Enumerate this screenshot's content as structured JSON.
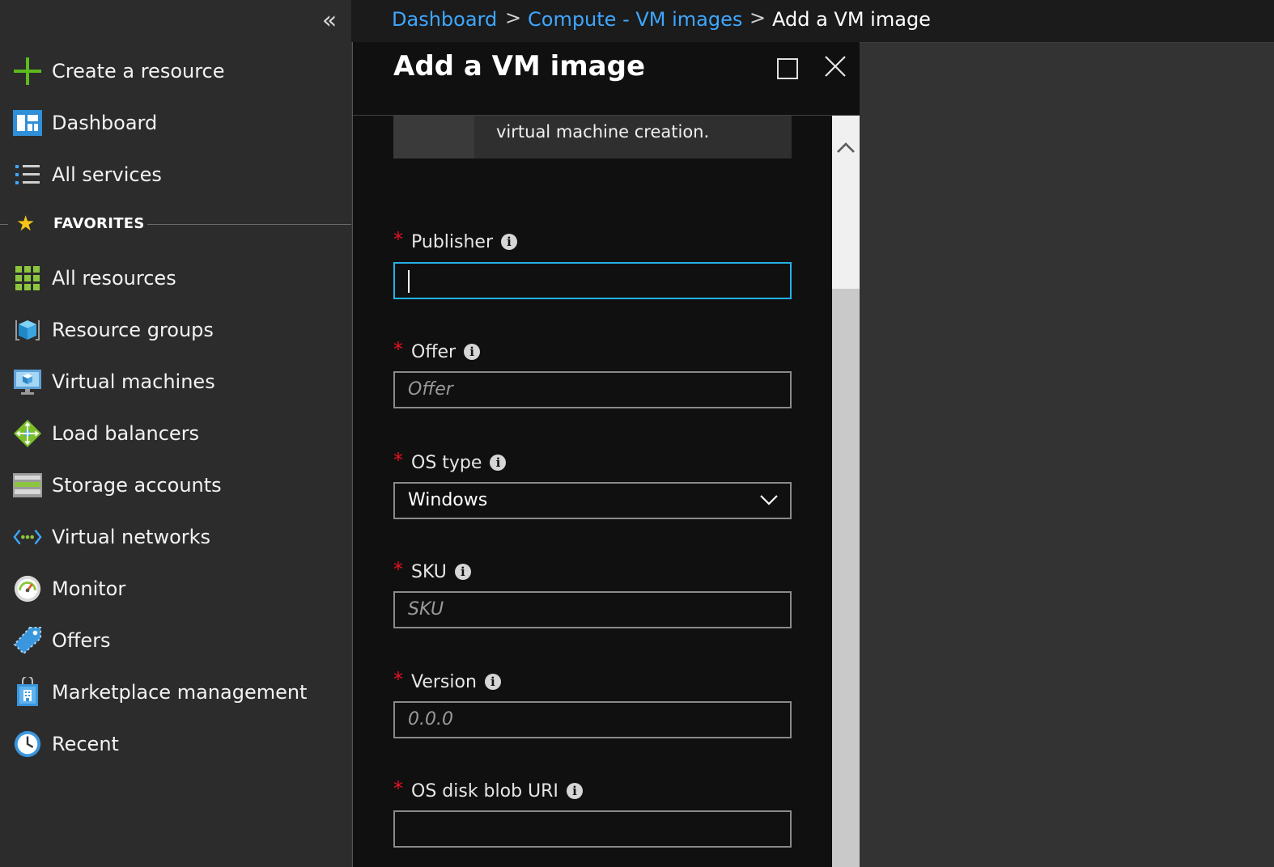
{
  "sidebar": {
    "collapse_label": "«",
    "top_items": [
      {
        "label": "Create a resource",
        "icon": "plus-icon"
      },
      {
        "label": "Dashboard",
        "icon": "dashboard-icon"
      },
      {
        "label": "All services",
        "icon": "list-icon"
      }
    ],
    "favorites_label": "FAVORITES",
    "favorites": [
      {
        "label": "All resources",
        "icon": "grid-icon"
      },
      {
        "label": "Resource groups",
        "icon": "cube-icon"
      },
      {
        "label": "Virtual machines",
        "icon": "monitor-icon"
      },
      {
        "label": "Load balancers",
        "icon": "diamond-icon"
      },
      {
        "label": "Storage accounts",
        "icon": "storage-icon"
      },
      {
        "label": "Virtual networks",
        "icon": "network-icon"
      },
      {
        "label": "Monitor",
        "icon": "gauge-icon"
      },
      {
        "label": "Offers",
        "icon": "tag-icon"
      },
      {
        "label": "Marketplace management",
        "icon": "shopping-bag-icon"
      },
      {
        "label": "Recent",
        "icon": "clock-icon"
      }
    ]
  },
  "breadcrumb": {
    "items": [
      "Dashboard",
      "Compute - VM images",
      "Add a VM image"
    ],
    "separator": ">"
  },
  "blade": {
    "title": "Add a VM image",
    "info_text": "virtual machine creation.",
    "fields": {
      "publisher": {
        "label": "Publisher",
        "value": ""
      },
      "offer": {
        "label": "Offer",
        "placeholder": "Offer"
      },
      "os_type": {
        "label": "OS type",
        "value": "Windows"
      },
      "sku": {
        "label": "SKU",
        "placeholder": "SKU"
      },
      "version": {
        "label": "Version",
        "placeholder": "0.0.0"
      },
      "os_disk_blob_uri": {
        "label": "OS disk blob URI",
        "value": ""
      }
    },
    "required_marker": "*",
    "info_glyph": "i"
  },
  "colors": {
    "accent": "#3ea7ff",
    "focus_border": "#23b3e8",
    "required": "#e81123",
    "sidebar_bg": "#2c2c2c",
    "blade_bg": "#101010"
  }
}
